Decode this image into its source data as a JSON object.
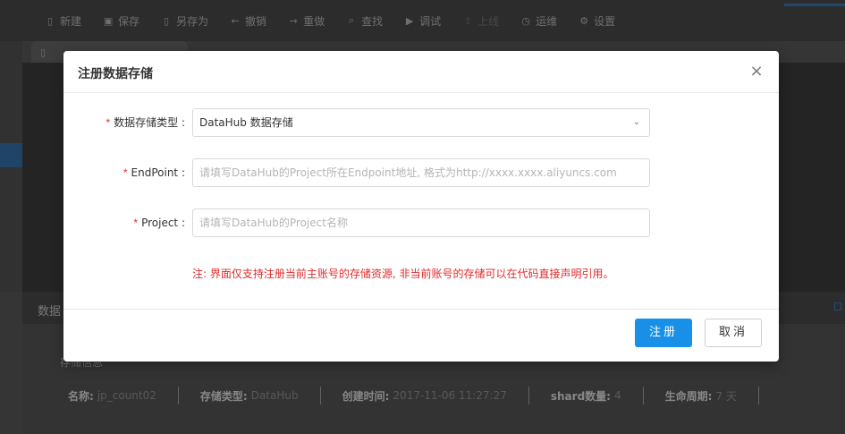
{
  "toolbar": {
    "items": [
      {
        "label": "新建",
        "icon": "new-file-icon",
        "glyph": "▯"
      },
      {
        "label": "保存",
        "icon": "save-icon",
        "glyph": "▣"
      },
      {
        "label": "另存为",
        "icon": "save-as-icon",
        "glyph": "▯"
      },
      {
        "label": "撤销",
        "icon": "undo-icon",
        "glyph": "←"
      },
      {
        "label": "重做",
        "icon": "redo-icon",
        "glyph": "→"
      },
      {
        "label": "查找",
        "icon": "search-icon",
        "glyph": "⌕"
      },
      {
        "label": "调试",
        "icon": "debug-icon",
        "glyph": "▶"
      },
      {
        "label": "上线",
        "icon": "deploy-icon",
        "glyph": "⇪"
      },
      {
        "label": "运维",
        "icon": "ops-icon",
        "glyph": "◷"
      },
      {
        "label": "设置",
        "icon": "settings-icon",
        "glyph": "⚙"
      }
    ]
  },
  "editor_tab": {
    "icon": "file-icon",
    "glyph": "▯"
  },
  "bottom_panel": {
    "title": "数据",
    "store_info_label": "存储信息",
    "info": [
      {
        "key": "名称:",
        "value": "jp_count02"
      },
      {
        "key": "存储类型:",
        "value": "DataHub"
      },
      {
        "key": "创建时间:",
        "value": "2017-11-06 11:27:27"
      },
      {
        "key": "shard数量:",
        "value": "4"
      },
      {
        "key": "生命周期:",
        "value": "7 天"
      }
    ]
  },
  "modal": {
    "title": "注册数据存储",
    "close_glyph": "×",
    "fields": {
      "store_type": {
        "label": "数据存储类型 :",
        "value": "DataHub 数据存储",
        "arrow": "⌄"
      },
      "endpoint": {
        "label": "EndPoint :",
        "placeholder": "请填写DataHub的Project所在Endpoint地址, 格式为http://xxxx.xxxx.aliyuncs.com"
      },
      "project": {
        "label": "Project :",
        "placeholder": "请填写DataHub的Project名称"
      }
    },
    "required_mark": "*",
    "note": "注: 界面仅支持注册当前主账号的存储资源, 非当前账号的存储可以在代码直接声明引用。",
    "buttons": {
      "register": "注册",
      "cancel": "取消"
    }
  },
  "colors": {
    "primary": "#1890e8",
    "required": "#e02b2b",
    "note": "#e02b2b"
  }
}
